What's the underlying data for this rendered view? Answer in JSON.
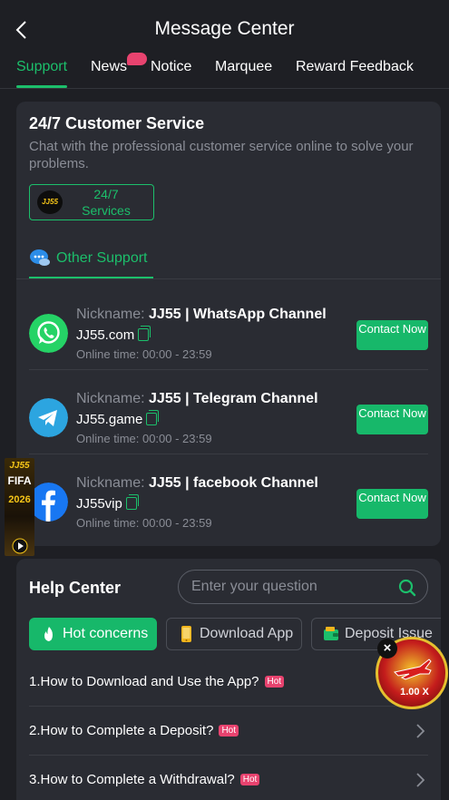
{
  "header": {
    "title": "Message Center"
  },
  "tabs": [
    {
      "label": "Support"
    },
    {
      "label": "News"
    },
    {
      "label": "Notice"
    },
    {
      "label": "Marquee"
    },
    {
      "label": "Reward Feedback"
    }
  ],
  "customer_service": {
    "title": "24/7 Customer Service",
    "description": "Chat with the professional customer service online to solve your problems.",
    "button_label": "24/7 Services",
    "logo_text": "JJ55"
  },
  "other_support": {
    "label": "Other Support"
  },
  "contacts": [
    {
      "nick_label": "Nickname:",
      "nickname": "JJ55 | WhatsApp Channel",
      "account": "JJ55.com",
      "online": "Online time:  00:00 - 23:59",
      "button": "Contact Now",
      "icon": "whatsapp-icon",
      "color": "#25d366"
    },
    {
      "nick_label": "Nickname:",
      "nickname": "JJ55 | Telegram Channel",
      "account": "JJ55.game",
      "online": "Online time:  00:00 - 23:59",
      "button": "Contact Now",
      "icon": "telegram-icon",
      "color": "#2ca5e0"
    },
    {
      "nick_label": "Nickname:",
      "nickname": "JJ55 | facebook Channel",
      "account": "JJ55vip",
      "online": "Online time:  00:00 - 23:59",
      "button": "Contact Now",
      "icon": "facebook-icon",
      "color": "#1877f2"
    }
  ],
  "help": {
    "title": "Help Center",
    "search_placeholder": "Enter your question",
    "chips": [
      {
        "label": "Hot concerns",
        "icon": "flame-icon"
      },
      {
        "label": "Download App",
        "icon": "phone-icon"
      },
      {
        "label": "Deposit Issue",
        "icon": "wallet-icon"
      }
    ],
    "questions": [
      {
        "text": "1.How to Download and Use the App?",
        "tag": "Hot"
      },
      {
        "text": "2.How to Complete a Deposit?",
        "tag": "Hot"
      },
      {
        "text": "3.How to Complete a Withdrawal?",
        "tag": "Hot"
      }
    ]
  },
  "side_banner": {
    "line1": "JJ55",
    "line2": "FIFA",
    "line3": "2026"
  },
  "floating_game": {
    "multiplier": "1.00 X"
  },
  "colors": {
    "accent": "#1cbf6b",
    "background": "#1e1f24",
    "card": "#2a2c33",
    "hot": "#e8436f"
  }
}
